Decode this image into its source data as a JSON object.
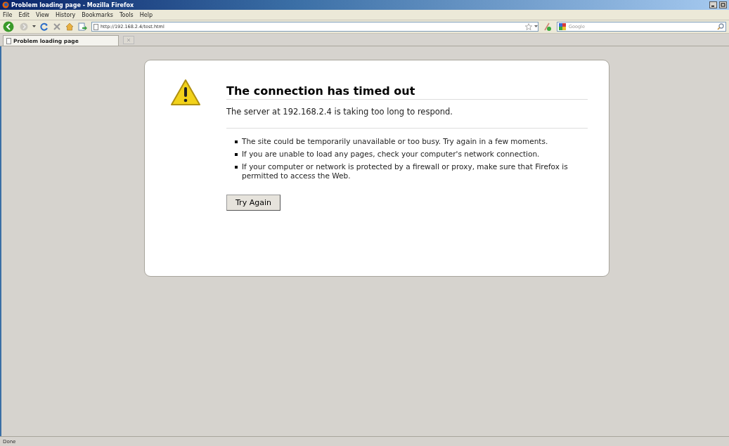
{
  "window": {
    "title": "Problem loading page - Mozilla Firefox"
  },
  "menu": [
    "File",
    "Edit",
    "View",
    "History",
    "Bookmarks",
    "Tools",
    "Help"
  ],
  "navigation": {
    "url": "http://192.168.2.4/test.html",
    "search_placeholder": "Google"
  },
  "tabs": [
    {
      "label": "Problem loading page",
      "selected": true
    }
  ],
  "error": {
    "title": "The connection has timed out",
    "message": "The server at 192.168.2.4 is taking too long to respond.",
    "hints": [
      "The site could be temporarily unavailable or too busy. Try again in a few moments.",
      "If you are unable to load any pages, check your computer's network connection.",
      "If your computer or network is protected by a firewall or proxy, make sure that Firefox is permitted to access the Web."
    ],
    "button": "Try Again"
  },
  "status_bar": "Done"
}
